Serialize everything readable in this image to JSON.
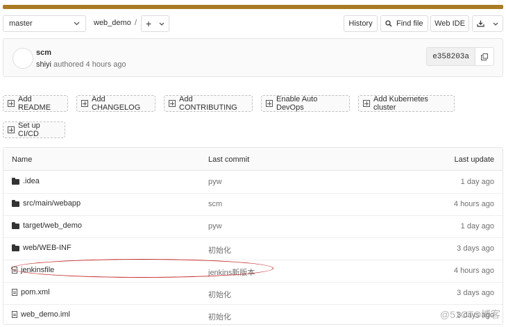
{
  "toolbar": {
    "branch": "master",
    "breadcrumb": "web_demo",
    "separator": "/",
    "add_symbol": "+",
    "history": "History",
    "find_file": "Find file",
    "web_ide": "Web IDE"
  },
  "commit": {
    "title": "scm",
    "author": "shiyi",
    "meta": "authored 4 hours ago",
    "sha": "e358203a"
  },
  "actions": [
    "Add README",
    "Add CHANGELOG",
    "Add CONTRIBUTING",
    "Enable Auto DevOps",
    "Add Kubernetes cluster",
    "Set up CI/CD"
  ],
  "table": {
    "headers": {
      "name": "Name",
      "last_commit": "Last commit",
      "last_update": "Last update"
    },
    "rows": [
      {
        "type": "folder",
        "name": ".idea",
        "commit": "pyw",
        "updated": "1 day ago"
      },
      {
        "type": "folder",
        "name": "src/main/webapp",
        "commit": "scm",
        "updated": "4 hours ago"
      },
      {
        "type": "folder",
        "name": "target/web_demo",
        "commit": "pyw",
        "updated": "1 day ago"
      },
      {
        "type": "folder",
        "name": "web/WEB-INF",
        "commit": "初始化",
        "updated": "3 days ago"
      },
      {
        "type": "file",
        "name": "jenkinsfile",
        "commit": "jenkins新版本",
        "updated": "4 hours ago"
      },
      {
        "type": "file",
        "name": "pom.xml",
        "commit": "初始化",
        "updated": "3 days ago"
      },
      {
        "type": "file",
        "name": "web_demo.iml",
        "commit": "初始化",
        "updated": "3 days ago"
      }
    ]
  },
  "watermark": "@51CTO博客",
  "colors": {
    "topbar": "#a97b22",
    "annotation": "#c62828"
  }
}
